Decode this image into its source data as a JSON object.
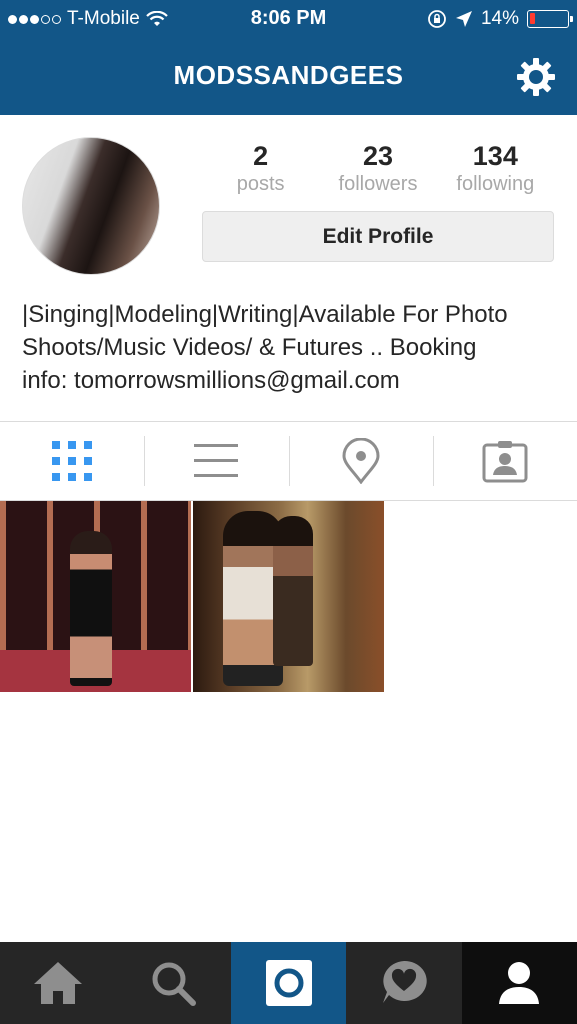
{
  "status_bar": {
    "carrier": "T-Mobile",
    "time": "8:06 PM",
    "battery_percent": "14%",
    "battery_level": 0.14,
    "signal_dots_filled": 3,
    "signal_dots_total": 5
  },
  "header": {
    "username": "MODSSANDGEES",
    "settings_icon": "gear-icon"
  },
  "profile": {
    "stats": [
      {
        "number": "2",
        "label": "posts"
      },
      {
        "number": "23",
        "label": "followers"
      },
      {
        "number": "134",
        "label": "following"
      }
    ],
    "edit_profile_label": "Edit Profile",
    "bio_lines": [
      "|Singing|Modeling|Writing|Available For Photo",
      "Shoots/Music Videos/ & Futures .. Booking",
      "info: tomorrowsmillions@gmail.com"
    ]
  },
  "tabs": [
    {
      "icon": "grid-icon",
      "active": true
    },
    {
      "icon": "list-icon",
      "active": false
    },
    {
      "icon": "location-pin-icon",
      "active": false
    },
    {
      "icon": "tagged-photos-icon",
      "active": false
    }
  ],
  "colors": {
    "brand_blue": "#125688",
    "active_tab": "#3897f0",
    "inactive_icon": "#8e8e8e",
    "battery_low": "#ff3b30"
  },
  "bottom_nav": [
    {
      "icon": "home-icon"
    },
    {
      "icon": "search-icon"
    },
    {
      "icon": "camera-icon"
    },
    {
      "icon": "activity-heart-icon"
    },
    {
      "icon": "profile-icon"
    }
  ]
}
